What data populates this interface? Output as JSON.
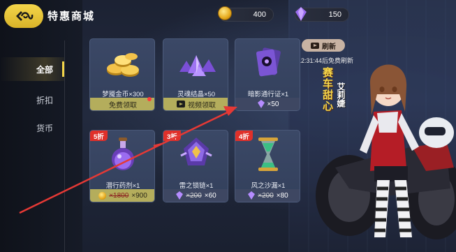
{
  "header": {
    "title": "特惠商城",
    "gold_amount": "400",
    "gem_amount": "150"
  },
  "sidebar": {
    "items": [
      {
        "label": "全部",
        "active": true
      },
      {
        "label": "折扣",
        "active": false
      },
      {
        "label": "货币",
        "active": false
      }
    ]
  },
  "refresh": {
    "label": "刷新",
    "info": "12:31:44后免费刷新"
  },
  "cards": [
    {
      "name": "梦魇金币×300",
      "price_type": "free",
      "price_label": "免费领取",
      "badge": ""
    },
    {
      "name": "灵魂结晶×50",
      "price_type": "video",
      "price_label": "视频领取",
      "badge": ""
    },
    {
      "name": "暗影通行证×1",
      "price_type": "gem",
      "price_label": "×50",
      "badge": ""
    },
    {
      "name": "潜行药剂×1",
      "price_type": "coin",
      "old_price": "×1800",
      "price_label": "×900",
      "badge": "5折"
    },
    {
      "name": "雷之锁链×1",
      "price_type": "gem",
      "old_price": "×200",
      "price_label": "×60",
      "badge": "3折"
    },
    {
      "name": "风之沙漏×1",
      "price_type": "gem",
      "old_price": "×200",
      "price_label": "×80",
      "badge": "4折"
    }
  ],
  "promo": {
    "title": "赛车甜心",
    "character_name": "艾莉婕"
  },
  "colors": {
    "accent_yellow": "#f4d64a",
    "discount_red": "#e0302a",
    "card_bg": "#3b4866",
    "annotation_red": "#e53935"
  },
  "icons": {
    "back": "back-logo-icon",
    "gold": "gold-coin-icon",
    "gem": "purple-gem-icon",
    "video": "video-icon"
  }
}
